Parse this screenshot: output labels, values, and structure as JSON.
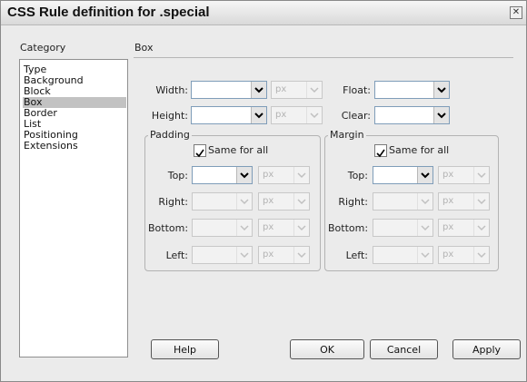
{
  "dialog": {
    "title": "CSS Rule definition for .special",
    "close_glyph": "✕"
  },
  "category": {
    "heading": "Category",
    "items": [
      "Type",
      "Background",
      "Block",
      "Box",
      "Border",
      "List",
      "Positioning",
      "Extensions"
    ],
    "selected": "Box"
  },
  "panel": {
    "heading": "Box"
  },
  "box": {
    "width_label": "Width:",
    "height_label": "Height:",
    "float_label": "Float:",
    "clear_label": "Clear:",
    "unit": "px"
  },
  "padding": {
    "legend": "Padding",
    "same_for_all": "Same for all",
    "top_label": "Top:",
    "right_label": "Right:",
    "bottom_label": "Bottom:",
    "left_label": "Left:"
  },
  "margin": {
    "legend": "Margin",
    "same_for_all": "Same for all",
    "top_label": "Top:",
    "right_label": "Right:",
    "bottom_label": "Bottom:",
    "left_label": "Left:"
  },
  "buttons": {
    "help": "Help",
    "ok": "OK",
    "cancel": "Cancel",
    "apply": "Apply"
  },
  "colors": {
    "dialog_bg": "#ebebeb",
    "selected_item": "#c2c2c2",
    "disabled_text": "#b3b3b3"
  }
}
